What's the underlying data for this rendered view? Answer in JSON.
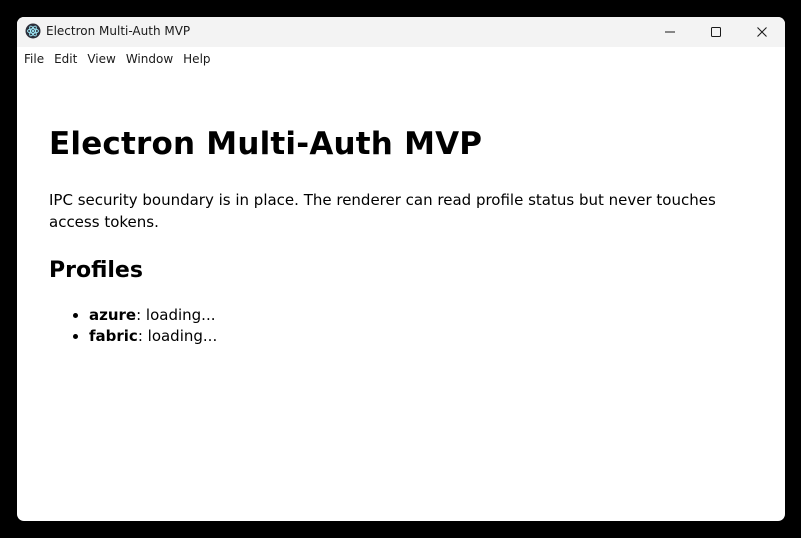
{
  "window": {
    "title": "Electron Multi-Auth MVP",
    "app_icon": "electron-atom-icon",
    "controls": {
      "minimize": "minimize-icon",
      "maximize": "maximize-icon",
      "close": "close-icon"
    }
  },
  "menubar": {
    "items": [
      "File",
      "Edit",
      "View",
      "Window",
      "Help"
    ]
  },
  "content": {
    "heading": "Electron Multi-Auth MVP",
    "intro": "IPC security boundary is in place. The renderer can read profile status but never touches access tokens.",
    "profiles_heading": "Profiles",
    "profiles": [
      {
        "name": "azure",
        "status": ": loading..."
      },
      {
        "name": "fabric",
        "status": ": loading..."
      }
    ]
  },
  "colors": {
    "titlebar_bg": "#f3f3f3",
    "page_bg": "#ffffff",
    "text": "#000000"
  }
}
